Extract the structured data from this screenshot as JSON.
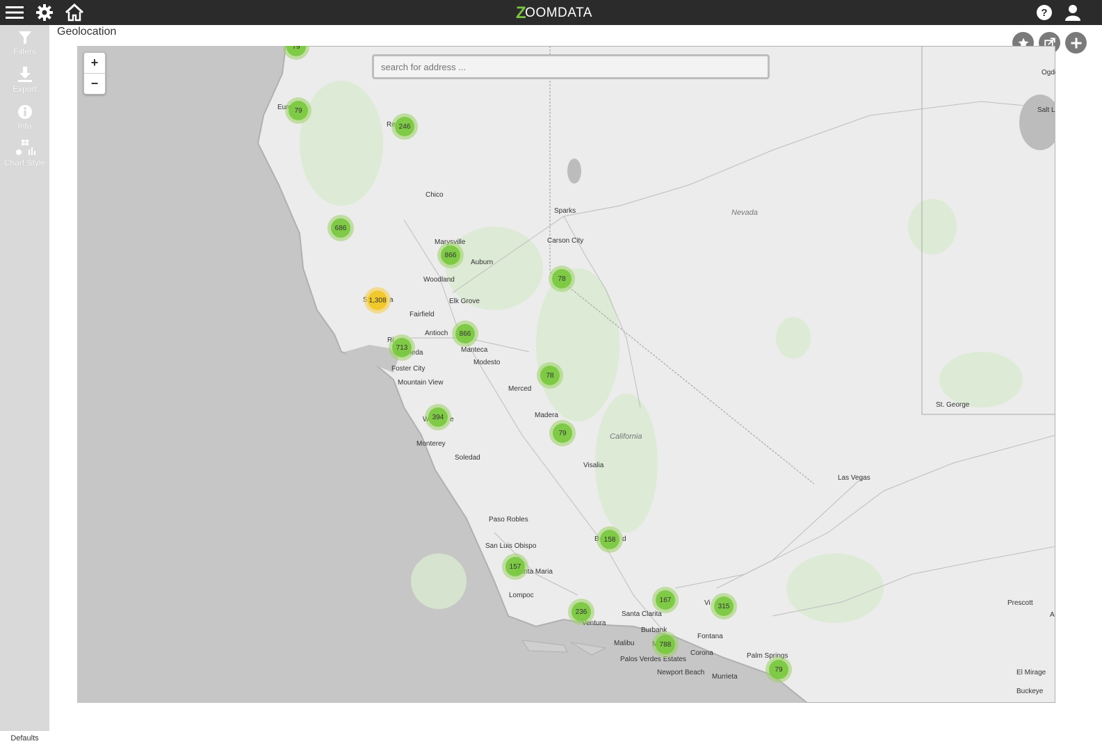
{
  "app": {
    "logo_text": "OOMDATA",
    "logo_letter": "Z"
  },
  "header": {
    "icons": [
      "menu-icon",
      "gear-icon",
      "home-icon",
      "help-icon",
      "user-icon"
    ]
  },
  "sidebar": {
    "items": [
      {
        "label": "Filters",
        "icon": "filter-icon"
      },
      {
        "label": "Export",
        "icon": "download-icon"
      },
      {
        "label": "Info",
        "icon": "info-icon"
      },
      {
        "label": "Chart Style",
        "icon": "chart-style-icon"
      }
    ],
    "defaults_label": "Defaults"
  },
  "page": {
    "title": "Geolocation"
  },
  "actions": {
    "icons": [
      "star-icon",
      "share-icon",
      "plus-icon"
    ]
  },
  "map": {
    "zoom_in": "+",
    "zoom_out": "−",
    "search_placeholder": "search for address ...",
    "regions": [
      "Nevada",
      "California"
    ],
    "cities": [
      "Eure",
      "Re",
      "Chico",
      "Sparks",
      "Carson City",
      "Marysville",
      "Auburn",
      "Woodland",
      "Elk Grove",
      "Sa",
      "a",
      "Fairfield",
      "Antioch",
      "Ri",
      "Alameda",
      "Manteca",
      "Modesto",
      "Foster City",
      "Mountain View",
      "Merced",
      "Madera",
      "W",
      "e",
      "Monterey",
      "Soledad",
      "Visalia",
      "Paso Robles",
      "San Luis Obispo",
      "Santa Maria",
      "Lompoc",
      "B",
      "d",
      "Santa Clarita",
      "Ventura",
      "Burbank",
      "Malibu",
      "M",
      "Palos Verdes Estates",
      "Newport Beach",
      "Fontana",
      "Corona",
      "Murrieta",
      "Palm Springs",
      "Vi",
      "Las Vegas",
      "St. George",
      "Prescott",
      "El Mirage",
      "Buckeye",
      "Salt La",
      "Ogde",
      "A"
    ],
    "clusters": [
      {
        "count": "79",
        "color": "green"
      },
      {
        "count": "79",
        "color": "green"
      },
      {
        "count": "246",
        "color": "green"
      },
      {
        "count": "686",
        "color": "green"
      },
      {
        "count": "866",
        "color": "green"
      },
      {
        "count": "78",
        "color": "green"
      },
      {
        "count": "1,308",
        "color": "yellow"
      },
      {
        "count": "866",
        "color": "green"
      },
      {
        "count": "713",
        "color": "green"
      },
      {
        "count": "78",
        "color": "green"
      },
      {
        "count": "394",
        "color": "green"
      },
      {
        "count": "79",
        "color": "green"
      },
      {
        "count": "158",
        "color": "green"
      },
      {
        "count": "157",
        "color": "green"
      },
      {
        "count": "236",
        "color": "green"
      },
      {
        "count": "167",
        "color": "green"
      },
      {
        "count": "315",
        "color": "green"
      },
      {
        "count": "788",
        "color": "green"
      },
      {
        "count": "79",
        "color": "green"
      }
    ]
  }
}
